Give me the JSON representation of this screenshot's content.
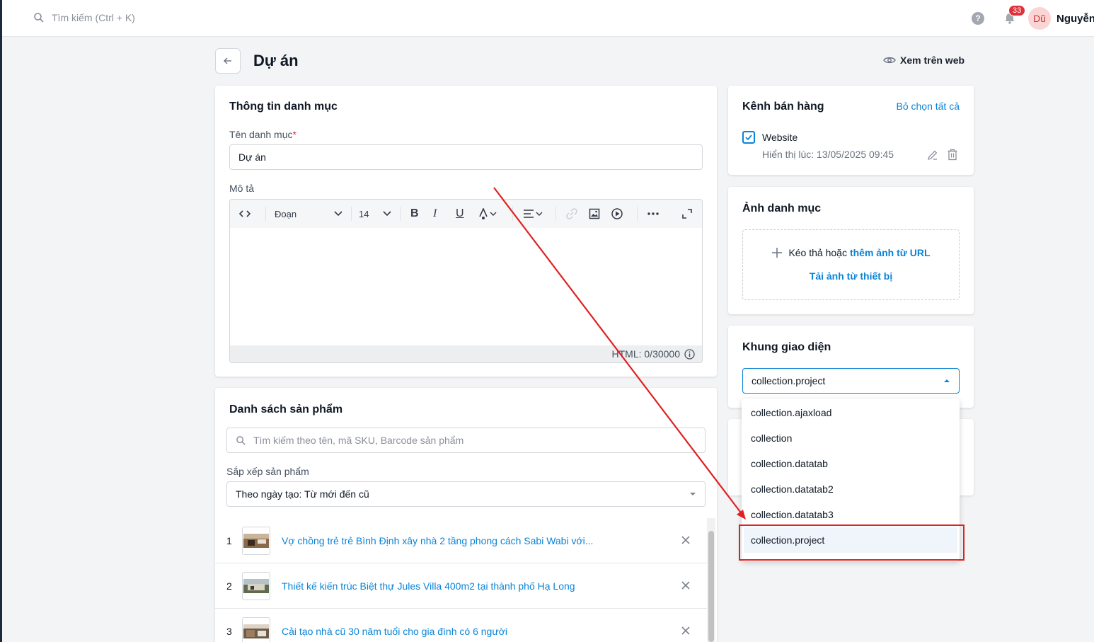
{
  "topbar": {
    "search_placeholder": "Tìm kiếm (Ctrl + K)",
    "notification_count": "33",
    "avatar_initials": "Dũ",
    "user_name": "Nguyễn"
  },
  "header": {
    "title": "Dự án",
    "view_on_web": "Xem trên web"
  },
  "category_info": {
    "title": "Thông tin danh mục",
    "name_label": "Tên danh mục",
    "name_required": "*",
    "name_value": "Dự án",
    "desc_label": "Mô tả",
    "toolbar": {
      "paragraph": "Đoạn",
      "font_size": "14"
    },
    "html_counter": "HTML: 0/30000"
  },
  "products": {
    "title": "Danh sách sản phẩm",
    "search_placeholder": "Tìm kiếm theo tên, mã SKU, Barcode sản phẩm",
    "sort_label": "Sắp xếp sản phẩm",
    "sort_value": "Theo ngày tạo: Từ mới đến cũ",
    "items": [
      {
        "index": "1",
        "name": "Vợ chồng trẻ trẻ Bình Định xây nhà 2 tầng phong cách Sabi Wabi với..."
      },
      {
        "index": "2",
        "name": "Thiết kế kiến trúc Biệt thự Jules Villa 400m2 tại thành phố Hạ Long"
      },
      {
        "index": "3",
        "name": "Cải tạo nhà cũ 30 năm tuổi cho gia đình có 6 người"
      }
    ]
  },
  "sales_channel": {
    "title": "Kênh bán hàng",
    "deselect_all": "Bỏ chọn tất cả",
    "channel_name": "Website",
    "display_time": "Hiển thị lúc: 13/05/2025 09:45"
  },
  "category_image": {
    "title": "Ảnh danh mục",
    "drag_text": "Kéo thả hoặc",
    "add_url_link": "thêm ảnh từ URL",
    "upload_link": "Tải ảnh từ thiết bị"
  },
  "template": {
    "title": "Khung giao diện",
    "selected": "collection.project",
    "options": [
      "collection.ajaxload",
      "collection",
      "collection.datatab",
      "collection.datatab2",
      "collection.datatab3",
      "collection.project"
    ]
  },
  "colors": {
    "accent": "#0a84d6",
    "annotation": "#e02020"
  }
}
